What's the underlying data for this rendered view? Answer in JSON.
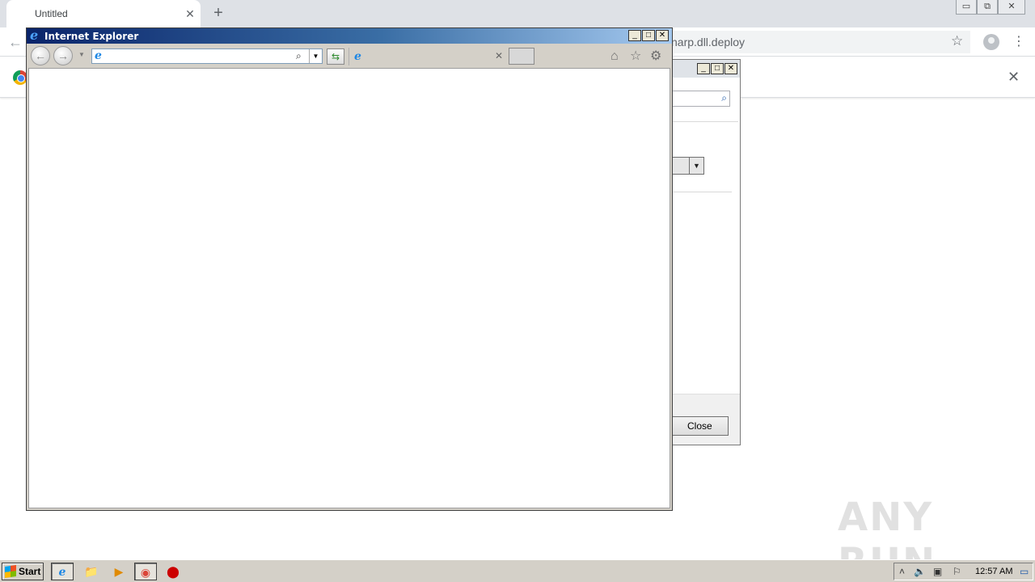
{
  "chrome": {
    "tab_title": "Untitled",
    "tab_close": "✕",
    "new_tab": "+",
    "window_buttons": {
      "minimize": "▭",
      "restore": "⧉",
      "close": "✕"
    },
    "back": "←",
    "url_suffix": "narp.dll.deploy",
    "star": "☆",
    "menu": "⋮",
    "infobar_close": "✕"
  },
  "dialog": {
    "buttons": {
      "minimize": "_",
      "maximize": "□",
      "close": "✕"
    },
    "search_icon": "⌕",
    "combo_arrow": "▼",
    "close_label": "Close"
  },
  "ie": {
    "title": "Internet Explorer",
    "title_icon": "e",
    "buttons": {
      "minimize": "_",
      "maximize": "□",
      "close": "✕"
    },
    "back": "←",
    "forward": "→",
    "history_dropdown": "▼",
    "address_value": "",
    "search_icon": "⌕",
    "address_dropdown": "▼",
    "refresh": "⇆",
    "tab_close": "✕",
    "home": "⌂",
    "favorites": "☆",
    "tools": "⚙"
  },
  "watermark": "ANY RUN",
  "taskbar": {
    "start_label": "Start",
    "items": [
      {
        "name": "internet-explorer",
        "glyph": "e"
      },
      {
        "name": "file-explorer",
        "glyph": "📁"
      },
      {
        "name": "media-player",
        "glyph": "▶"
      },
      {
        "name": "chrome",
        "glyph": "◉"
      },
      {
        "name": "stop",
        "glyph": "⬤"
      }
    ],
    "tray": {
      "arrow": "˄",
      "volume": "🔈",
      "network": "▣",
      "flag": "⚐",
      "desktop": "▭"
    },
    "clock": "12:57 AM"
  },
  "colors": {
    "ie_title_start": "#0a246a",
    "ie_title_end": "#a6caf0",
    "taskbar": "#d4d0c8",
    "chrome_tabstrip": "#dee1e6"
  }
}
